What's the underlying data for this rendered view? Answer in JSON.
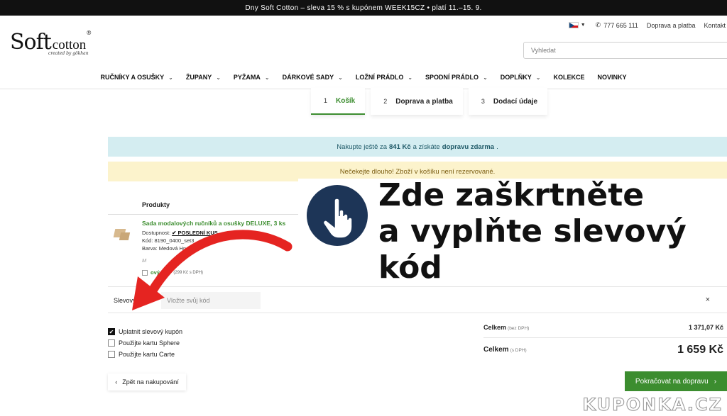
{
  "promo_bar": "Dny Soft Cotton – sleva 15 % s kupónem WEEK15CZ • platí 11.–15. 9.",
  "logo": {
    "main": "Soft",
    "cotton": "cotton",
    "registered": "®",
    "sub": "created by gökhan"
  },
  "util": {
    "phone": "777 665 111",
    "shipping": "Doprava a platba",
    "contact": "Kontakt"
  },
  "search": {
    "placeholder": "Vyhledat"
  },
  "nav": [
    {
      "label": "RUČNÍKY A OSUŠKY",
      "has_dropdown": true
    },
    {
      "label": "ŽUPANY",
      "has_dropdown": true
    },
    {
      "label": "PYŽAMA",
      "has_dropdown": true
    },
    {
      "label": "DÁRKOVÉ SADY",
      "has_dropdown": true
    },
    {
      "label": "LOŽNÍ PRÁDLO",
      "has_dropdown": true
    },
    {
      "label": "SPODNÍ PRÁDLO",
      "has_dropdown": true
    },
    {
      "label": "DOPLŇKY",
      "has_dropdown": true
    },
    {
      "label": "KOLEKCE",
      "has_dropdown": false
    },
    {
      "label": "NOVINKY",
      "has_dropdown": false
    }
  ],
  "steps": [
    {
      "num": "1",
      "label": "Košík",
      "active": true
    },
    {
      "num": "2",
      "label": "Doprava a platba",
      "active": false
    },
    {
      "num": "3",
      "label": "Dodací údaje",
      "active": false
    }
  ],
  "banner_ship": {
    "pre": "Nakupte ještě za",
    "amount": "841 Kč",
    "mid": "a získáte",
    "free": "dopravu zdarma",
    "end": "."
  },
  "banner_warn": "Nečekejte dlouho! Zboží v košíku není rezervované.",
  "table": {
    "header": "Produkty"
  },
  "product": {
    "name": "Sada modalových ručníků a osušky DELUXE, 3 ks",
    "availability_label": "Dostupnost:",
    "availability_value": "✔ POSLEDNÍ KUS",
    "code": "Kód: 8190_0400_set3",
    "color": "Barva: Medová Hn",
    "note": "M",
    "giftbox_label": "ový box",
    "giftbox_price": "(299 Kč s DPH)"
  },
  "coupon": {
    "label": "Slevový k",
    "placeholder": "Vložte svůj kód",
    "close": "×"
  },
  "options": [
    {
      "label": "Uplatnit slevový kupón",
      "checked": true
    },
    {
      "label": "Použijte kartu Sphere",
      "checked": false
    },
    {
      "label": "Použijte kartu Carte",
      "checked": false
    }
  ],
  "summary": {
    "excl_label": "Celkem",
    "excl_note": "(bez DPH)",
    "excl_value": "1 371,07 Kč",
    "incl_label": "Celkem",
    "incl_note": "(s DPH)",
    "incl_value": "1 659 Kč"
  },
  "buttons": {
    "back": "Zpět na nakupování",
    "continue": "Pokračovat na dopravu"
  },
  "callout": {
    "line1": "Zde zaškrtněte",
    "line2": "a vyplňte slevový",
    "line3": "kód"
  },
  "watermark": "KUPONKA.CZ",
  "colors": {
    "brand_green": "#3c8d2f",
    "annotation_red": "#e52421",
    "hand_badge": "#1d3557"
  }
}
